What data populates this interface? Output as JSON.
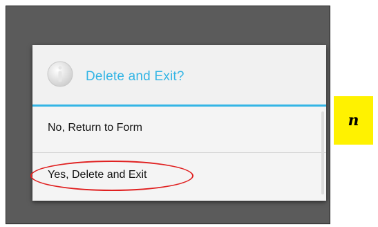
{
  "dialog": {
    "title": "Delete and Exit?",
    "icon": "info-icon",
    "options": [
      {
        "label": "No, Return to Form"
      },
      {
        "label": "Yes, Delete and Exit"
      }
    ]
  },
  "annotation": {
    "badge_text": "n",
    "highlight_color": "#e02020",
    "badge_color": "#fff200"
  },
  "colors": {
    "accent": "#33b5e5",
    "overlay": "#5b5b5b",
    "dialog_bg": "#f4f4f4"
  }
}
